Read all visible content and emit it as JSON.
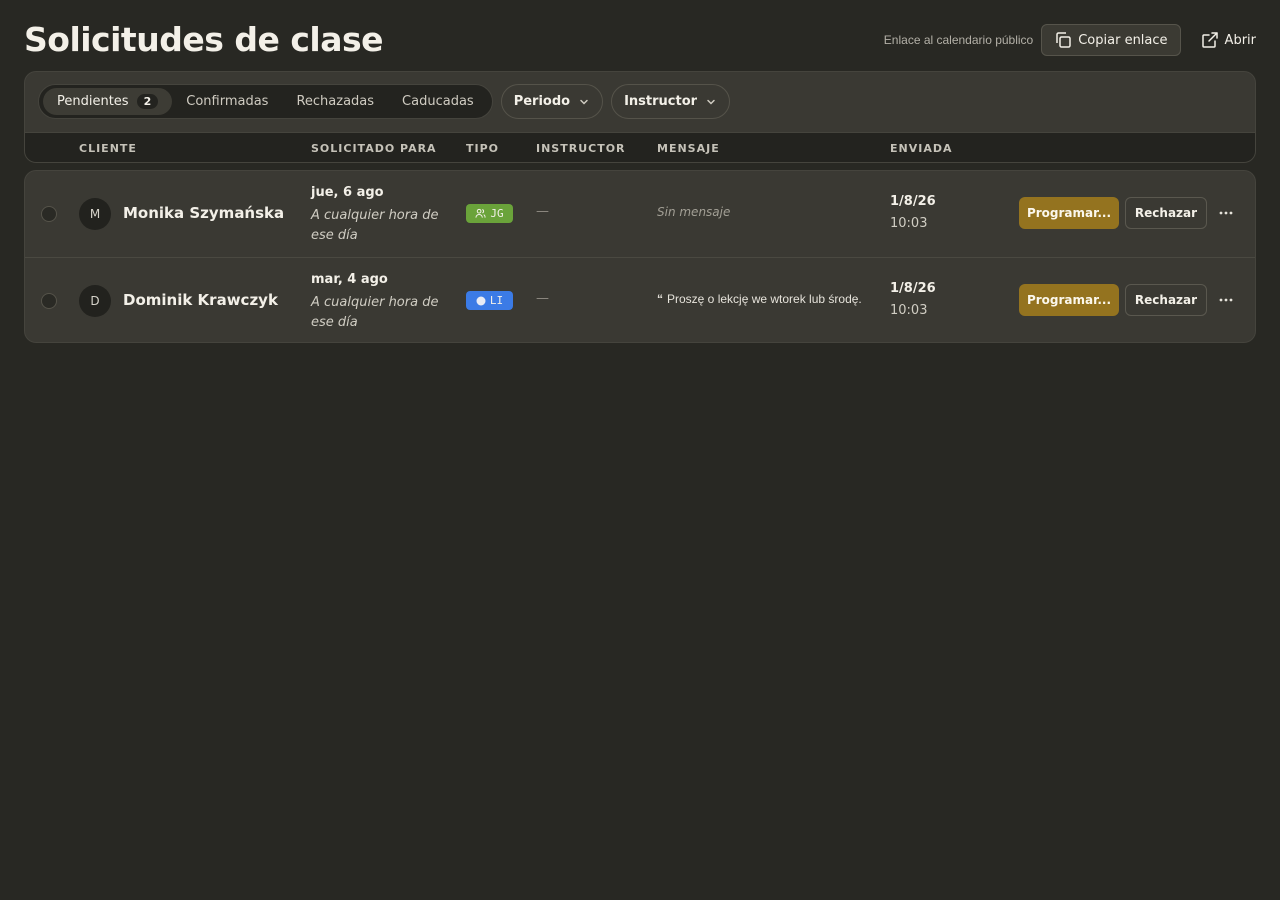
{
  "page": {
    "title": "Solicitudes de clase"
  },
  "header": {
    "public_link_label": "Enlace al calendario público",
    "copy_label": "Copiar enlace",
    "copy_icon": "copy-icon",
    "open_label": "Abrir",
    "open_icon": "external-link-icon"
  },
  "filters": {
    "tabs": [
      {
        "label": "Pendientes",
        "count": "2",
        "active": true
      },
      {
        "label": "Confirmadas"
      },
      {
        "label": "Rechazadas"
      },
      {
        "label": "Caducadas"
      }
    ],
    "period_label": "Periodo",
    "instructor_label": "Instructor"
  },
  "columns": {
    "client": "CLIENTE",
    "requested_for": "SOLICITADO PARA",
    "type": "TIPO",
    "instructor": "INSTRUCTOR",
    "message": "MENSAJE",
    "sent": "ENVIADA"
  },
  "rows": [
    {
      "initial": "M",
      "name": "Monika Szymańska",
      "date": "jue, 6 ago",
      "time": "A cualquier hora de ese día",
      "type_code": "JG",
      "type_icon": "group-icon",
      "type_color": "#6aa33a",
      "instructor": "—",
      "message": "Sin mensaje",
      "sent_date": "1/8/26",
      "sent_time": "10:03",
      "schedule_label": "Programar...",
      "reject_label": "Rechazar"
    },
    {
      "initial": "D",
      "name": "Dominik Krawczyk",
      "date": "mar, 4 ago",
      "time": "A cualquier hora de ese día",
      "type_code": "LI",
      "type_icon": "dot-icon",
      "type_color": "#3b7be6",
      "instructor": "—",
      "message": "Proszę o lekcję we wtorek lub środę.",
      "sent_date": "1/8/26",
      "sent_time": "10:03",
      "schedule_label": "Programar...",
      "reject_label": "Rechazar"
    }
  ],
  "colors": {
    "background": "#282823",
    "panel": "#3a3933",
    "accent": "#94731f"
  }
}
